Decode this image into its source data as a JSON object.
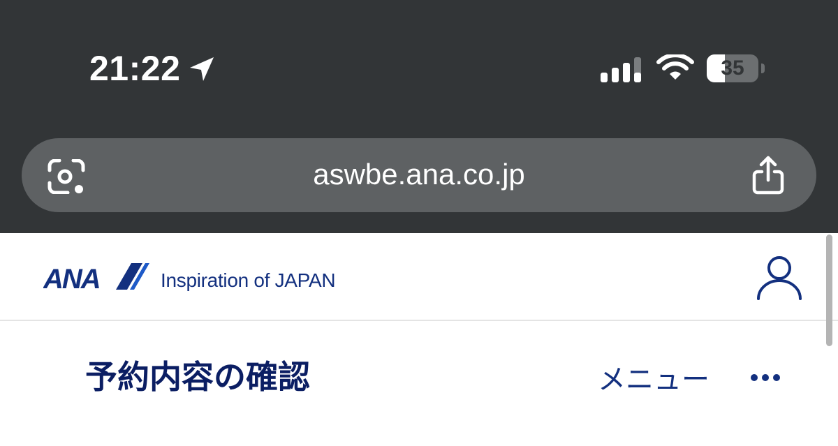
{
  "status_bar": {
    "time": "21:22",
    "battery_level": "35",
    "battery_fraction": 0.35,
    "icons": [
      "location-arrow-icon",
      "cellular-signal-icon",
      "wifi-icon",
      "battery-icon"
    ]
  },
  "browser": {
    "url": "aswbe.ana.co.jp",
    "left_icon": "google-lens-icon",
    "right_icon": "share-icon"
  },
  "site_header": {
    "logo_text": "ANA",
    "tagline": "Inspiration of JAPAN",
    "account_icon": "user-icon"
  },
  "page": {
    "title": "予約内容の確認",
    "menu_label": "メニュー",
    "menu_icon": "more-horizontal-icon"
  },
  "colors": {
    "browser_chrome": "#323537",
    "url_bar": "#5e6163",
    "ana_navy": "#13307f",
    "ana_blue": "#1e5ac8",
    "title_navy": "#0b1e63"
  }
}
